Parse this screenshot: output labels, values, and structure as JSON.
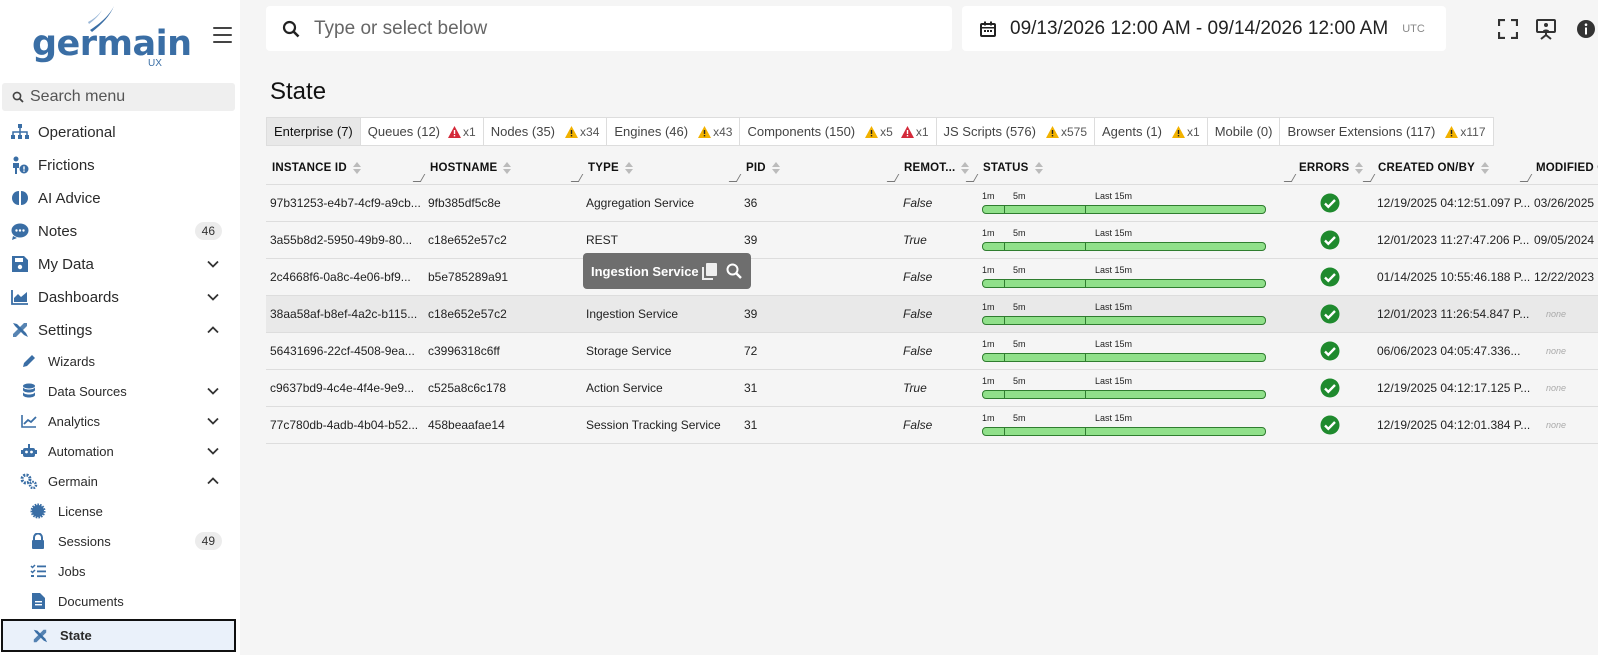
{
  "app": {
    "logo_text": "germain",
    "logo_sub": "UX"
  },
  "sidebar": {
    "search_placeholder": "Search menu",
    "items": [
      {
        "label": "Operational"
      },
      {
        "label": "Frictions"
      },
      {
        "label": "AI Advice"
      },
      {
        "label": "Notes",
        "badge": "46"
      },
      {
        "label": "My Data"
      },
      {
        "label": "Dashboards"
      },
      {
        "label": "Settings"
      }
    ],
    "settings_children": [
      {
        "label": "Wizards"
      },
      {
        "label": "Data Sources"
      },
      {
        "label": "Analytics"
      },
      {
        "label": "Automation"
      },
      {
        "label": "Germain"
      }
    ],
    "germain_children": [
      {
        "label": "License"
      },
      {
        "label": "Sessions",
        "badge": "49"
      },
      {
        "label": "Jobs"
      },
      {
        "label": "Documents"
      },
      {
        "label": "State"
      }
    ]
  },
  "topbar": {
    "search_placeholder": "Type or select below",
    "date_range": "09/13/2026 12:00 AM - 09/14/2026 12:00 AM",
    "timezone": "UTC"
  },
  "page": {
    "title": "State"
  },
  "tabs": [
    {
      "label": "Enterprise (7)",
      "active": true
    },
    {
      "label": "Queues (12)",
      "red": "x1"
    },
    {
      "label": "Nodes (35)",
      "warn": "x34"
    },
    {
      "label": "Engines (46)",
      "warn": "x43"
    },
    {
      "label": "Components (150)",
      "warn": "x5",
      "red": "x1"
    },
    {
      "label": "JS Scripts (576)",
      "warn": "x575"
    },
    {
      "label": "Agents (1)",
      "warn": "x1"
    },
    {
      "label": "Mobile (0)"
    },
    {
      "label": "Browser Extensions (117)",
      "warn": "x117"
    }
  ],
  "grid": {
    "columns": [
      "INSTANCE ID",
      "HOSTNAME",
      "TYPE",
      "PID",
      "REMOT...",
      "STATUS",
      "ERRORS",
      "CREATED ON/BY",
      "MODIFIED O"
    ],
    "status_labels": {
      "a": "1m",
      "b": "5m",
      "c": "Last 15m"
    },
    "rows": [
      {
        "id": "97b31253-e4b7-4cf9-a9cb...",
        "host": "9fb385df5c8e",
        "type": "Aggregation Service",
        "pid": "36",
        "remote": "False",
        "created": "12/19/2025 04:12:51.097 P...",
        "modified": "03/26/2025"
      },
      {
        "id": "3a55b8d2-5950-49b9-80...",
        "host": "c18e652e57c2",
        "type": "REST",
        "pid": "39",
        "remote": "True",
        "created": "12/01/2023 11:27:47.206 P...",
        "modified": "09/05/2024"
      },
      {
        "id": "2c4668f6-0a8c-4e06-bf9...",
        "host": "b5e785289a91",
        "type": "",
        "pid": "",
        "remote": "False",
        "created": "01/14/2025 10:55:46.188 P...",
        "modified": "12/22/2023"
      },
      {
        "id": "38aa58af-b8ef-4a2c-b115...",
        "host": "c18e652e57c2",
        "type": "Ingestion Service",
        "pid": "39",
        "remote": "False",
        "created": "12/01/2023 11:26:54.847 P...",
        "modified": "none"
      },
      {
        "id": "56431696-22cf-4508-9ea...",
        "host": "c3996318c6ff",
        "type": "Storage Service",
        "pid": "72",
        "remote": "False",
        "created": "06/06/2023 04:05:47.336...",
        "modified": "none"
      },
      {
        "id": "c9637bd9-4c4e-4f4e-9e9...",
        "host": "c525a8c6c178",
        "type": "Action Service",
        "pid": "31",
        "remote": "True",
        "created": "12/19/2025 04:12:17.125 P...",
        "modified": "none"
      },
      {
        "id": "77c780db-4adb-4b04-b52...",
        "host": "458beaafae14",
        "type": "Session Tracking Service",
        "pid": "31",
        "remote": "False",
        "created": "12/19/2025 04:12:01.384 P...",
        "modified": "none"
      }
    ]
  },
  "tooltip": {
    "text": "Ingestion Service"
  },
  "colors": {
    "brand": "#3a6ea5",
    "ok": "#1f8a2e",
    "warn": "#f2b200",
    "error": "#d42a3a",
    "status_fill": "#90e08a"
  }
}
